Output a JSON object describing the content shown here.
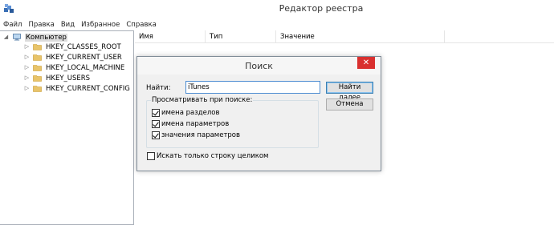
{
  "window": {
    "title": "Редактор реестра",
    "icon": "registry-editor-icon"
  },
  "menu": [
    "Файл",
    "Правка",
    "Вид",
    "Избранное",
    "Справка"
  ],
  "tree": {
    "root": "Компьютер",
    "keys": [
      "HKEY_CLASSES_ROOT",
      "HKEY_CURRENT_USER",
      "HKEY_LOCAL_MACHINE",
      "HKEY_USERS",
      "HKEY_CURRENT_CONFIG"
    ]
  },
  "list": {
    "columns": [
      "Имя",
      "Тип",
      "Значение"
    ]
  },
  "dialog": {
    "title": "Поиск",
    "find_label": "Найти:",
    "find_value": "iTunes",
    "find_next": "Найти далее",
    "cancel": "Отмена",
    "lookat_legend": "Просматривать при поиске:",
    "options": [
      {
        "label": "имена разделов",
        "checked": true
      },
      {
        "label": "имена параметров",
        "checked": true
      },
      {
        "label": "значения параметров",
        "checked": true
      }
    ],
    "whole_string": {
      "label": "Искать только строку целиком",
      "checked": false
    }
  },
  "colors": {
    "close_button": "#d9302f",
    "folder": "#e8c46a",
    "input_border": "#4c8cd1"
  }
}
